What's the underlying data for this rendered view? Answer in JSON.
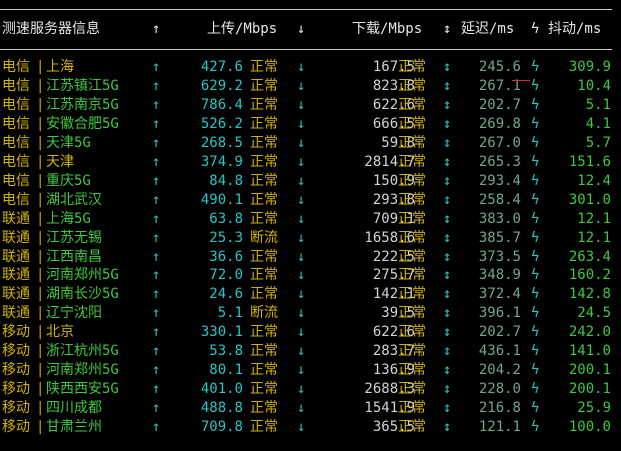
{
  "header": {
    "title": "测速服务器信息",
    "up_arrow": "↑",
    "upload": "上传/Mbps",
    "down_arrow_hdr": "↓",
    "download": "下载/Mbps",
    "sort": "↕",
    "latency": "延迟/ms",
    "flash": "ϟ",
    "jitter": "抖动/ms"
  },
  "rows": [
    {
      "isp": "电信",
      "city": "上海",
      "city_color": "yellow",
      "up": "427.6",
      "up_status": "正常",
      "down": "167.5",
      "down_status": "正常",
      "latency": "245.6",
      "jitter": "309.9"
    },
    {
      "isp": "电信",
      "city": "江苏镇江5G",
      "city_color": "green",
      "up": "629.2",
      "up_status": "正常",
      "down": "823.8",
      "down_status": "正常",
      "latency": "267.1",
      "jitter": "10.4"
    },
    {
      "isp": "电信",
      "city": "江苏南京5G",
      "city_color": "green",
      "up": "786.4",
      "up_status": "正常",
      "down": "622.6",
      "down_status": "正常",
      "latency": "202.7",
      "jitter": "5.1"
    },
    {
      "isp": "电信",
      "city": "安徽合肥5G",
      "city_color": "green",
      "up": "526.2",
      "up_status": "正常",
      "down": "666.5",
      "down_status": "正常",
      "latency": "269.8",
      "jitter": "4.1"
    },
    {
      "isp": "电信",
      "city": "天津5G",
      "city_color": "green",
      "up": "268.5",
      "up_status": "正常",
      "down": "59.8",
      "down_status": "正常",
      "latency": "267.0",
      "jitter": "5.7"
    },
    {
      "isp": "电信",
      "city": "天津",
      "city_color": "yellow",
      "up": "374.9",
      "up_status": "正常",
      "down": "2814.7",
      "down_status": "正常",
      "latency": "265.3",
      "jitter": "151.6"
    },
    {
      "isp": "电信",
      "city": "重庆5G",
      "city_color": "green",
      "up": "84.8",
      "up_status": "正常",
      "down": "150.9",
      "down_status": "正常",
      "latency": "293.4",
      "jitter": "12.4"
    },
    {
      "isp": "电信",
      "city": "湖北武汉",
      "city_color": "green",
      "up": "490.1",
      "up_status": "正常",
      "down": "293.8",
      "down_status": "正常",
      "latency": "258.4",
      "jitter": "301.0"
    },
    {
      "isp": "联通",
      "city": "上海5G",
      "city_color": "green",
      "up": "63.8",
      "up_status": "正常",
      "down": "709.1",
      "down_status": "正常",
      "latency": "383.0",
      "jitter": "12.1"
    },
    {
      "isp": "联通",
      "city": "江苏无锡",
      "city_color": "green",
      "up": "25.3",
      "up_status": "断流",
      "down": "1658.6",
      "down_status": "正常",
      "latency": "385.7",
      "jitter": "12.1"
    },
    {
      "isp": "联通",
      "city": "江西南昌",
      "city_color": "green",
      "up": "36.6",
      "up_status": "正常",
      "down": "222.5",
      "down_status": "正常",
      "latency": "373.5",
      "jitter": "263.4"
    },
    {
      "isp": "联通",
      "city": "河南郑州5G",
      "city_color": "green",
      "up": "72.0",
      "up_status": "正常",
      "down": "275.7",
      "down_status": "正常",
      "latency": "348.9",
      "jitter": "160.2"
    },
    {
      "isp": "联通",
      "city": "湖南长沙5G",
      "city_color": "green",
      "up": "24.6",
      "up_status": "正常",
      "down": "142.1",
      "down_status": "正常",
      "latency": "372.4",
      "jitter": "142.8"
    },
    {
      "isp": "联通",
      "city": "辽宁沈阳",
      "city_color": "green",
      "up": "5.1",
      "up_status": "断流",
      "down": "39.5",
      "down_status": "正常",
      "latency": "396.1",
      "jitter": "24.5"
    },
    {
      "isp": "移动",
      "city": "北京",
      "city_color": "yellow",
      "up": "330.1",
      "up_status": "正常",
      "down": "622.6",
      "down_status": "正常",
      "latency": "202.7",
      "jitter": "242.0"
    },
    {
      "isp": "移动",
      "city": "浙江杭州5G",
      "city_color": "green",
      "up": "53.8",
      "up_status": "正常",
      "down": "283.7",
      "down_status": "正常",
      "latency": "436.1",
      "jitter": "141.0"
    },
    {
      "isp": "移动",
      "city": "河南郑州5G",
      "city_color": "green",
      "up": "80.1",
      "up_status": "正常",
      "down": "136.9",
      "down_status": "正常",
      "latency": "204.2",
      "jitter": "200.1"
    },
    {
      "isp": "移动",
      "city": "陕西西安5G",
      "city_color": "green",
      "up": "401.0",
      "up_status": "正常",
      "down": "2688.3",
      "down_status": "正常",
      "latency": "228.0",
      "jitter": "200.1"
    },
    {
      "isp": "移动",
      "city": "四川成都",
      "city_color": "green",
      "up": "488.8",
      "up_status": "正常",
      "down": "1541.9",
      "down_status": "正常",
      "latency": "216.8",
      "jitter": "25.9"
    },
    {
      "isp": "移动",
      "city": "甘肃兰州",
      "city_color": "green",
      "up": "709.8",
      "up_status": "正常",
      "down": "365.5",
      "down_status": "正常",
      "latency": "121.1",
      "jitter": "100.0"
    }
  ],
  "glyphs": {
    "bar": "|",
    "up_arrow": "↑",
    "down_arrow": "↓",
    "sort_arrow": "↕",
    "flash": "ϟ"
  },
  "colors": {
    "background": "#000000",
    "isp": "#d2b400",
    "city_green": "#3ec83e",
    "cyan": "#29c4c4",
    "status": "#d0b000",
    "latency": "#6fa888",
    "jitter": "#3ec83e"
  }
}
